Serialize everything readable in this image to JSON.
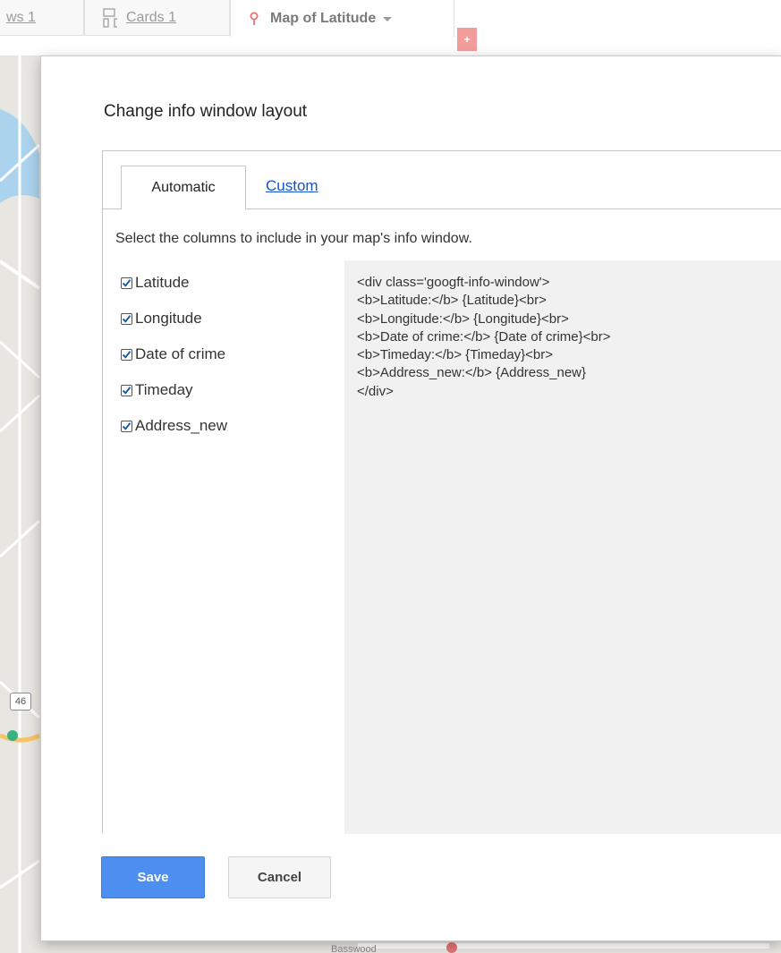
{
  "top_tabs": {
    "rows_label": "ws 1",
    "cards_label": "Cards 1",
    "map_label": "Map of Latitude",
    "add_label": "+"
  },
  "map": {
    "shield": "46",
    "place_label": "Basswood"
  },
  "dialog": {
    "title": "Change info window layout",
    "tabs": {
      "automatic": "Automatic",
      "custom": "Custom"
    },
    "instruction": "Select the columns to include in your map's info window.",
    "columns": [
      {
        "label": "Latitude",
        "checked": true
      },
      {
        "label": "Longitude",
        "checked": true
      },
      {
        "label": "Date of crime",
        "checked": true
      },
      {
        "label": "Timeday",
        "checked": true
      },
      {
        "label": "Address_new",
        "checked": true
      }
    ],
    "template_code": "<div class='googft-info-window'>\n<b>Latitude:</b> {Latitude}<br>\n<b>Longitude:</b> {Longitude}<br>\n<b>Date of crime:</b> {Date of crime}<br>\n<b>Timeday:</b> {Timeday}<br>\n<b>Address_new:</b> {Address_new}\n</div>",
    "buttons": {
      "save": "Save",
      "cancel": "Cancel"
    }
  }
}
